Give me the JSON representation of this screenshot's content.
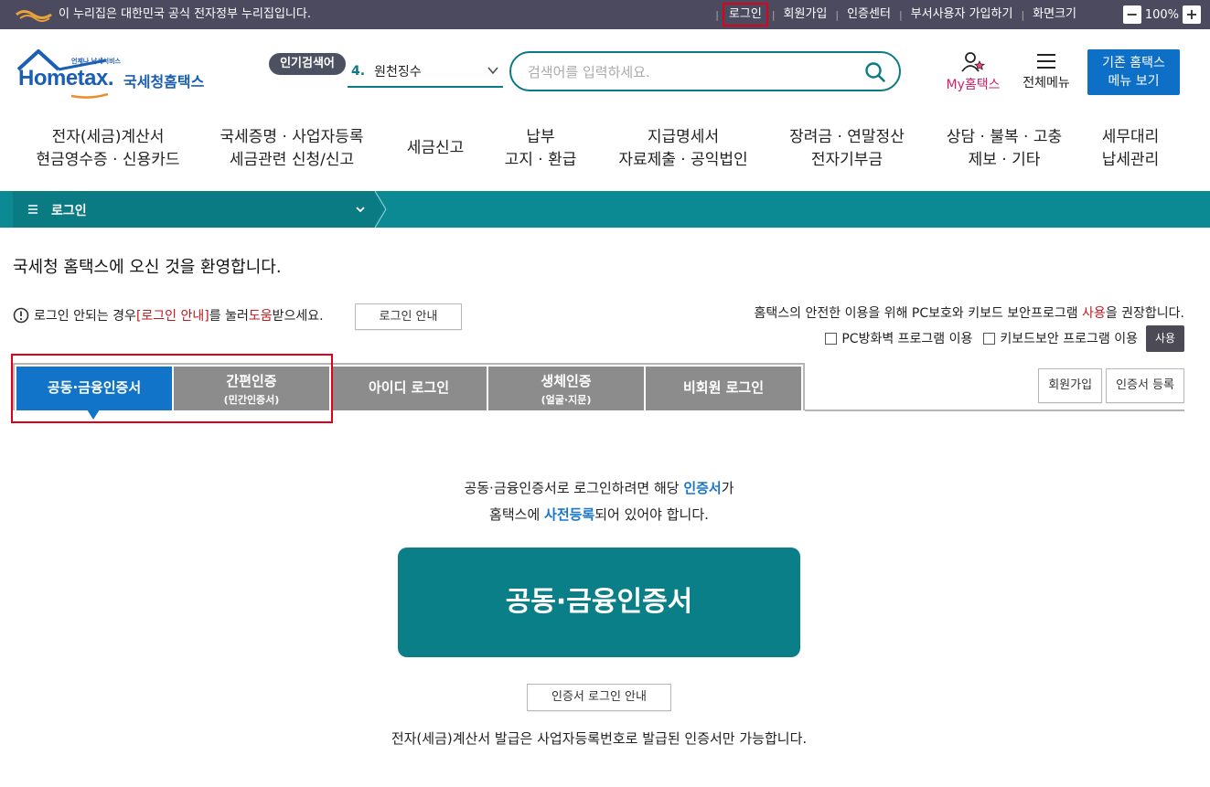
{
  "gov_bar": {
    "notice": "이 누리집은 대한민국 공식 전자정부 누리집입니다.",
    "links": [
      "로그인",
      "회원가입",
      "인증센터",
      "부서사용자 가입하기",
      "화면크기"
    ],
    "zoom": "100%",
    "zoom_out": "−",
    "zoom_in": "+"
  },
  "header": {
    "logo_tagline": "언제나 납세서비스",
    "logo_main": "Hometax.",
    "logo_kr": "국세청홈택스",
    "popular_label": "인기검색어",
    "popular_rank": "4.",
    "popular_keyword": "원천징수",
    "search_placeholder": "검색어를 입력하세요.",
    "my_hometax": "My홈택스",
    "all_menu": "전체메뉴",
    "legacy_line1": "기존 홈택스",
    "legacy_line2": "메뉴 보기"
  },
  "gnb": [
    {
      "l1": "전자(세금)계산서",
      "l2": "현금영수증 · 신용카드"
    },
    {
      "l1": "국세증명 · 사업자등록",
      "l2": "세금관련 신청/신고"
    },
    {
      "l1": "세금신고",
      "l2": ""
    },
    {
      "l1": "납부",
      "l2": "고지 · 환급"
    },
    {
      "l1": "지급명세서",
      "l2": "자료제출 · 공익법인"
    },
    {
      "l1": "장려금 · 연말정산",
      "l2": "전자기부금"
    },
    {
      "l1": "상담 · 불복 · 고충",
      "l2": "제보 · 기타"
    },
    {
      "l1": "세무대리",
      "l2": "납세관리"
    }
  ],
  "location": {
    "current": "로그인"
  },
  "content": {
    "welcome": "국세청 홈택스에 오신 것을 환영합니다.",
    "help_pre": "로그인 안되는 경우 ",
    "help_link": "[로그인 안내]",
    "help_mid": "를 눌러 ",
    "help_em": "도움",
    "help_post": "받으세요.",
    "login_guide_btn": "로그인 안내",
    "security_pre": "홈택스의 안전한 이용을 위해 PC보호와 키보드 보안프로그램 ",
    "security_em": "사용",
    "security_post": "을 권장합니다.",
    "opt_firewall": "PC방화벽 프로그램 이용",
    "opt_keyboard": "키보드보안 프로그램 이용",
    "use_btn": "사용"
  },
  "tabs": [
    {
      "main": "공동·금융인증서",
      "sub": "",
      "active": true
    },
    {
      "main": "간편인증",
      "sub": "(민간인증서)",
      "active": false
    },
    {
      "main": "아이디 로그인",
      "sub": "",
      "active": false
    },
    {
      "main": "생체인증",
      "sub": "(얼굴·지문)",
      "active": false
    },
    {
      "main": "비회원 로그인",
      "sub": "",
      "active": false
    }
  ],
  "side_buttons": {
    "join": "회원가입",
    "register_cert": "인증서 등록"
  },
  "panel": {
    "line1_pre": "공동·금융인증서로 로그인하려면 해당 ",
    "line1_em": "인증서",
    "line1_post": "가",
    "line2_pre": "홈택스에 ",
    "line2_em": "사전등록",
    "line2_post": "되어 있어야 합니다.",
    "cert_button": "공동·금융인증서",
    "cert_guide_btn": "인증서 로그인 안내",
    "notice": "전자(세금)계산서 발급은 사업자등록번호로 발급된 인증서만 가능합니다."
  },
  "colors": {
    "gov_bar": "#4b4a5f",
    "teal": "#0b8a93",
    "active_tab": "#1174c9",
    "inactive_tab": "#8c8c8c",
    "highlight": "#e0001b"
  }
}
